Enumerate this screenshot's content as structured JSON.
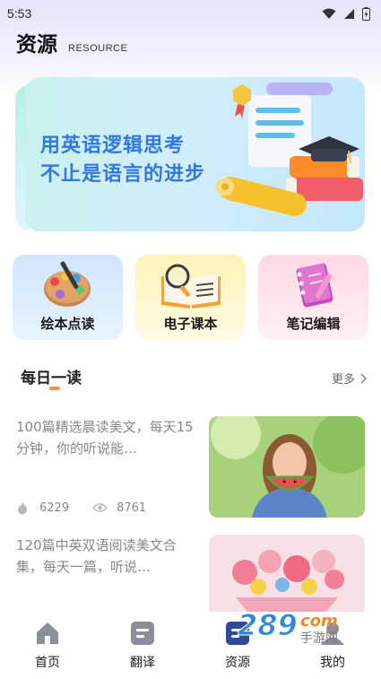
{
  "status_bar": {
    "time": "5:53"
  },
  "header": {
    "title": "资源",
    "subtitle": "RESOURCE"
  },
  "banner": {
    "line1": "用英语逻辑思考",
    "line2": "不止是语言的进步"
  },
  "quick_actions": [
    {
      "label": "绘本点读",
      "icon": "palette-icon"
    },
    {
      "label": "电子课本",
      "icon": "open-book-icon"
    },
    {
      "label": "笔记编辑",
      "icon": "notebook-icon"
    }
  ],
  "daily": {
    "title": "每日一读",
    "more": "更多"
  },
  "articles": [
    {
      "text": "100篇精选晨读美文，每天15分钟，你的听说能…",
      "likes": "6229",
      "views": "8761",
      "image": "girl-eating-watermelon"
    },
    {
      "text": "120篇中英双语阅读美文合集，每天一篇，听说…",
      "image": "flower-bouquet"
    }
  ],
  "bottom_nav": [
    {
      "label": "首页",
      "icon": "home-icon"
    },
    {
      "label": "翻译",
      "icon": "translate-icon"
    },
    {
      "label": "资源",
      "icon": "resource-icon",
      "active": true
    },
    {
      "label": "我的",
      "icon": "profile-icon"
    }
  ],
  "watermark": {
    "text": "289",
    "suffix": "com",
    "sub": "手游网"
  },
  "colors": {
    "accent": "#3277e6",
    "indicator": "#f5963b",
    "text_muted": "#888888"
  }
}
